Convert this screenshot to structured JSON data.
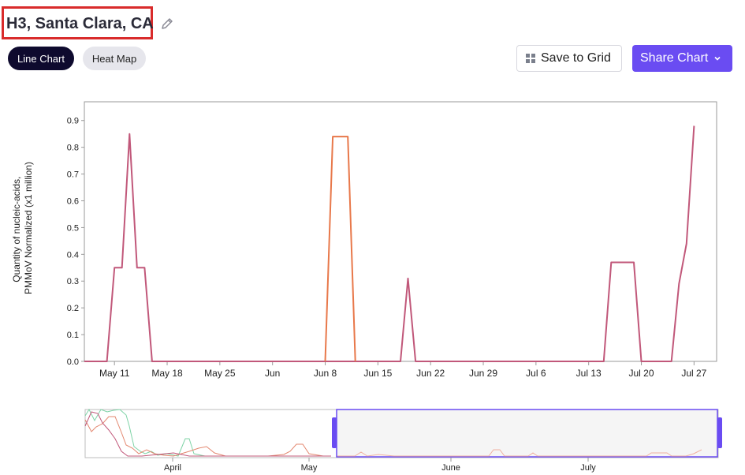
{
  "header": {
    "title": "H3, Santa Clara, CA",
    "edit_icon": "pencil-icon"
  },
  "toolbar": {
    "line_chart_label": "Line Chart",
    "heat_map_label": "Heat Map",
    "save_label": "Save to Grid",
    "share_label": "Share Chart",
    "save_icon": "grid-icon",
    "share_icon": "chevron-down-icon"
  },
  "colors": {
    "accent": "#6a4cf2",
    "series_primary": "#c1587a",
    "series_secondary": "#e8784a",
    "active_tab": "#0e0a2e",
    "highlight_box": "#d92b2b"
  },
  "chart_data": {
    "type": "line",
    "ylabel": "Quantity of nucleic-acids, PMMoV Normalized (x1 million)",
    "ylim": [
      0,
      0.97
    ],
    "yticks": [
      0.0,
      0.1,
      0.2,
      0.3,
      0.4,
      0.5,
      0.6,
      0.7,
      0.8,
      0.9
    ],
    "xlim": [
      "2024-05-07",
      "2024-07-30"
    ],
    "xticks": [
      {
        "date": "2024-05-11",
        "label": "May 11"
      },
      {
        "date": "2024-05-18",
        "label": "May 18"
      },
      {
        "date": "2024-05-25",
        "label": "May 25"
      },
      {
        "date": "2024-06-01",
        "label": "Jun"
      },
      {
        "date": "2024-06-08",
        "label": "Jun 8"
      },
      {
        "date": "2024-06-15",
        "label": "Jun 15"
      },
      {
        "date": "2024-06-22",
        "label": "Jun 22"
      },
      {
        "date": "2024-06-29",
        "label": "Jun 29"
      },
      {
        "date": "2024-07-06",
        "label": "Jul 6"
      },
      {
        "date": "2024-07-13",
        "label": "Jul 13"
      },
      {
        "date": "2024-07-20",
        "label": "Jul 20"
      },
      {
        "date": "2024-07-27",
        "label": "Jul 27"
      }
    ],
    "grid": false,
    "legend": "none",
    "series": [
      {
        "color": "#c1587a",
        "points": [
          [
            "2024-05-07",
            0
          ],
          [
            "2024-05-10",
            0
          ],
          [
            "2024-05-11",
            0.35
          ],
          [
            "2024-05-12",
            0.35
          ],
          [
            "2024-05-13",
            0.85
          ],
          [
            "2024-05-14",
            0.35
          ],
          [
            "2024-05-15",
            0.35
          ],
          [
            "2024-05-16",
            0
          ],
          [
            "2024-06-18",
            0
          ],
          [
            "2024-06-19",
            0.31
          ],
          [
            "2024-06-20",
            0
          ],
          [
            "2024-07-15",
            0
          ],
          [
            "2024-07-16",
            0.37
          ],
          [
            "2024-07-18",
            0.37
          ],
          [
            "2024-07-19",
            0.37
          ],
          [
            "2024-07-20",
            0
          ],
          [
            "2024-07-24",
            0
          ],
          [
            "2024-07-25",
            0.29
          ],
          [
            "2024-07-26",
            0.44
          ],
          [
            "2024-07-27",
            0.88
          ]
        ]
      },
      {
        "color": "#e8784a",
        "points": [
          [
            "2024-06-08",
            0
          ],
          [
            "2024-06-09",
            0.84
          ],
          [
            "2024-06-10",
            0.84
          ],
          [
            "2024-06-11",
            0.84
          ],
          [
            "2024-06-12",
            0
          ]
        ]
      }
    ],
    "navigator": {
      "labels": [
        "April",
        "May",
        "June",
        "July"
      ],
      "selected_range": [
        "2024-05-07",
        "2024-07-30"
      ]
    }
  }
}
